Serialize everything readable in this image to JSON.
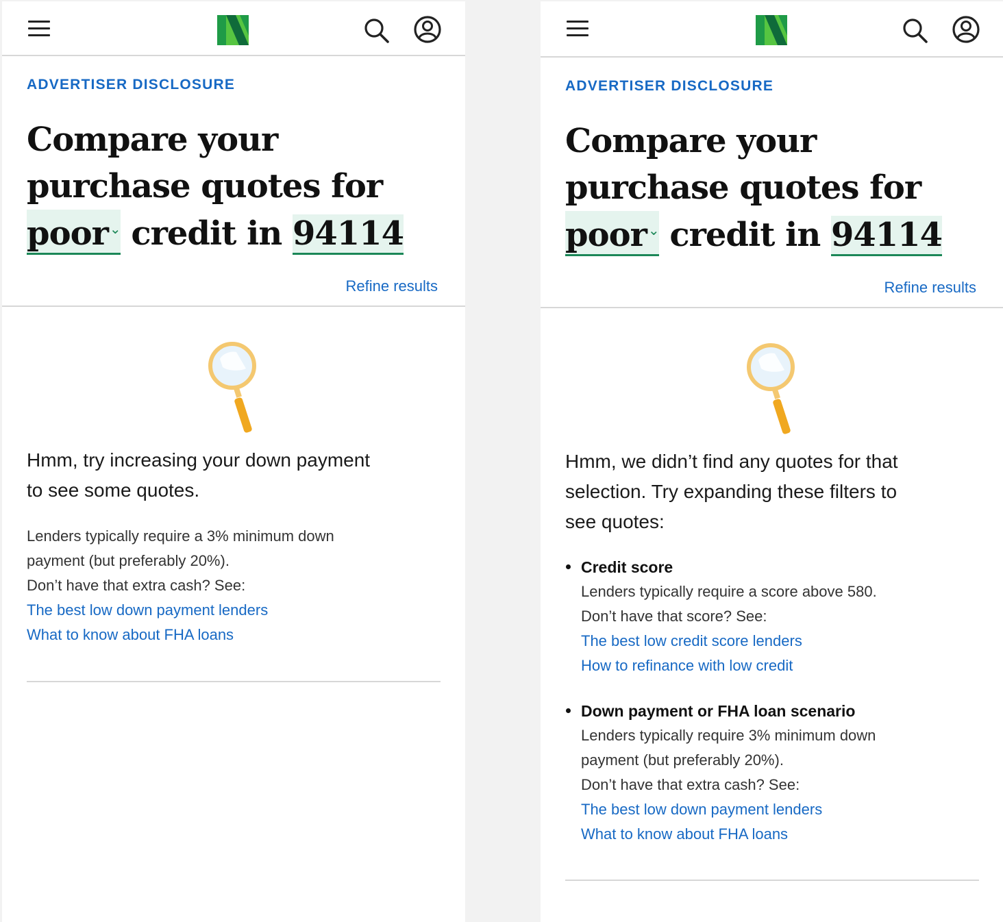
{
  "header": {
    "menu_icon": "hamburger-menu-icon",
    "logo_icon": "nerdwallet-n-logo",
    "search_icon": "search-icon",
    "account_icon": "account-icon"
  },
  "colors": {
    "link": "#1769c4",
    "accent_green": "#1b8757",
    "pill_bg": "#e5f4ee",
    "magnifier": "#f2c060"
  },
  "left": {
    "disclosure": "ADVERTISER DISCLOSURE",
    "headline": {
      "line1": "Compare your",
      "line2": "purchase quotes for",
      "credit_value": "poor",
      "middle": "credit in",
      "zip": "94114"
    },
    "refine": "Refine results",
    "empty_title": {
      "line1": "Hmm, try increasing your down payment",
      "line2": "to see some quotes."
    },
    "body": {
      "line1": "Lenders typically require a 3% minimum down",
      "line2": "payment (but preferably 20%).",
      "line3": "Don’t have that extra cash? See:"
    },
    "links": [
      "The best low down payment lenders",
      "What to know about FHA loans"
    ]
  },
  "right": {
    "disclosure": "ADVERTISER DISCLOSURE",
    "headline": {
      "line1": "Compare your",
      "line2": "purchase quotes for",
      "credit_value": "poor",
      "middle": "credit in",
      "zip": "94114"
    },
    "refine": "Refine results",
    "empty_title": {
      "line1": "Hmm, we didn’t find any quotes for that",
      "line2": "selection. Try expanding these filters to",
      "line3": "see quotes:"
    },
    "filters": [
      {
        "title": "Credit score",
        "line1": "Lenders typically require a score above 580.",
        "line2": "Don’t have that score? See:",
        "links": [
          "The best low credit score lenders",
          "How to refinance with low credit"
        ]
      },
      {
        "title": "Down payment or FHA loan scenario",
        "line1": "Lenders typically require 3% minimum down",
        "line2": "payment (but preferably 20%).",
        "line3": "Don’t have that extra cash? See:",
        "links": [
          "The best low down payment lenders",
          "What to know about FHA loans"
        ]
      }
    ]
  }
}
